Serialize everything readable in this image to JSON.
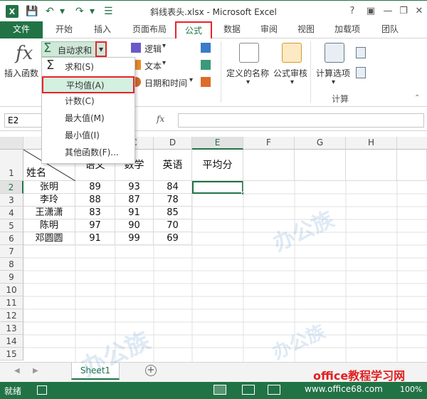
{
  "window": {
    "title": "斜线表头.xlsx - Microsoft Excel",
    "help": "?",
    "minimize": "—",
    "restore": "❐",
    "close": "✕"
  },
  "tabs": {
    "file": "文件",
    "home": "开始",
    "insert": "插入",
    "page_layout": "页面布局",
    "formulas": "公式",
    "data": "数据",
    "review": "审阅",
    "view": "视图",
    "addins": "加载项",
    "team": "团队"
  },
  "ribbon": {
    "insert_function": "插入函数",
    "autosum": "自动求和",
    "logical": "逻辑",
    "text": "文本",
    "datetime": "日期和时间",
    "defined_names": "定义的名称",
    "formula_auditing": "公式审核",
    "calc_options": "计算选项",
    "calc_group": "计算"
  },
  "autosum_menu": {
    "sum": "求和(S)",
    "average": "平均值(A)",
    "count": "计数(C)",
    "max": "最大值(M)",
    "min": "最小值(I)",
    "more": "其他函数(F)..."
  },
  "formula_bar": {
    "name_box": "E2",
    "fx": "fx",
    "value": ""
  },
  "columns": [
    "E",
    "F",
    "G",
    "H"
  ],
  "visible_col_labels": {
    "C": "C",
    "D": "D"
  },
  "rows": [
    "1",
    "2",
    "3",
    "4",
    "5",
    "6",
    "7",
    "8",
    "9",
    "10",
    "11",
    "12",
    "13",
    "14",
    "15"
  ],
  "header_row": {
    "name": "姓名",
    "chinese": "语文",
    "math": "数学",
    "english": "英语",
    "avg": "平均分"
  },
  "data_rows": [
    {
      "name": "张明",
      "chinese": "89",
      "math": "93",
      "english": "84"
    },
    {
      "name": "李玲",
      "chinese": "88",
      "math": "87",
      "english": "78"
    },
    {
      "name": "王潇潇",
      "chinese": "83",
      "math": "91",
      "english": "85"
    },
    {
      "name": "陈明",
      "chinese": "97",
      "math": "90",
      "english": "70"
    },
    {
      "name": "邓圆圆",
      "chinese": "91",
      "math": "99",
      "english": "69"
    }
  ],
  "sheet": {
    "tab": "Sheet1",
    "add": "+"
  },
  "status": {
    "ready": "就绪",
    "zoom": "100%"
  },
  "watermark": {
    "site": "office教程学习网",
    "url": "www.office68.com"
  }
}
